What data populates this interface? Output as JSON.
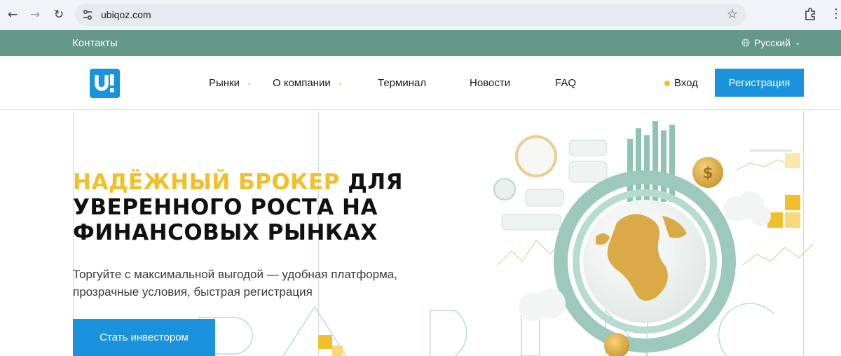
{
  "browser": {
    "url": "ubiqoz.com",
    "icons": [
      "back-icon",
      "forward-icon",
      "reload-icon",
      "site-settings-icon",
      "bookmark-star-icon",
      "extensions-icon",
      "more-menu-icon"
    ]
  },
  "topbar": {
    "contacts_label": "Контакты",
    "language_label": "Русский",
    "bg_color": "#66988a"
  },
  "header": {
    "logo_text": "U!",
    "nav": [
      {
        "label": "Рынки",
        "dropdown": true
      },
      {
        "label": "О компании",
        "dropdown": true
      },
      {
        "label": "Терминал",
        "dropdown": false
      },
      {
        "label": "Новости",
        "dropdown": false
      },
      {
        "label": "FAQ",
        "dropdown": false
      }
    ],
    "login_label": "Вход",
    "register_label": "Регистрация",
    "accent_color": "#1a92dc",
    "gold_color": "#f2bf2c"
  },
  "hero": {
    "title_accent": "НАДЁЖНЫЙ БРОКЕР",
    "title_rest_1": " ДЛЯ",
    "title_line_2": "УВЕРЕННОГО РОСТА НА",
    "title_line_3": "ФИНАНСОВЫХ РЫНКАХ",
    "subtitle_line_1": "Торгуйте с максимальной выгодой — удобная платформа,",
    "subtitle_line_2": "прозрачные условия, быстрая регистрация",
    "cta_label": "Стать инвестором",
    "background_word": "TRADING"
  }
}
